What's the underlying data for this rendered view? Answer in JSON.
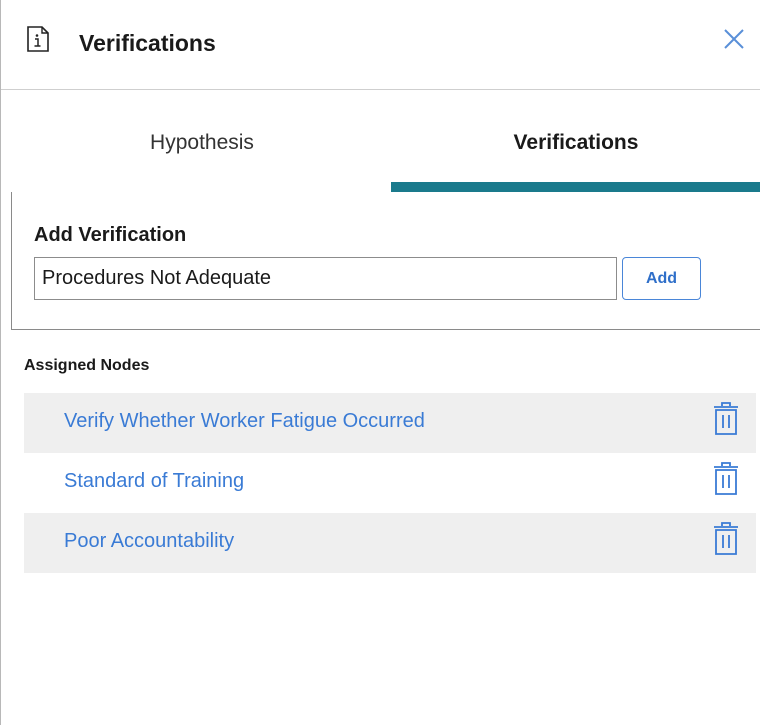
{
  "header": {
    "title": "Verifications",
    "info_icon": "info-document-icon",
    "close_icon": "close-icon"
  },
  "tabs": [
    {
      "label": "Hypothesis",
      "active": false
    },
    {
      "label": "Verifications",
      "active": true
    }
  ],
  "add_verification": {
    "label": "Add Verification",
    "input_value": "Procedures Not Adequate",
    "button_label": "Add"
  },
  "assigned_nodes": {
    "title": "Assigned Nodes",
    "items": [
      {
        "label": "Verify Whether Worker Fatigue Occurred"
      },
      {
        "label": "Standard of Training"
      },
      {
        "label": "Poor Accountability"
      }
    ]
  },
  "colors": {
    "accent": "#1a7a8c",
    "link": "#3a7bd5",
    "row_shade": "#efefef"
  }
}
